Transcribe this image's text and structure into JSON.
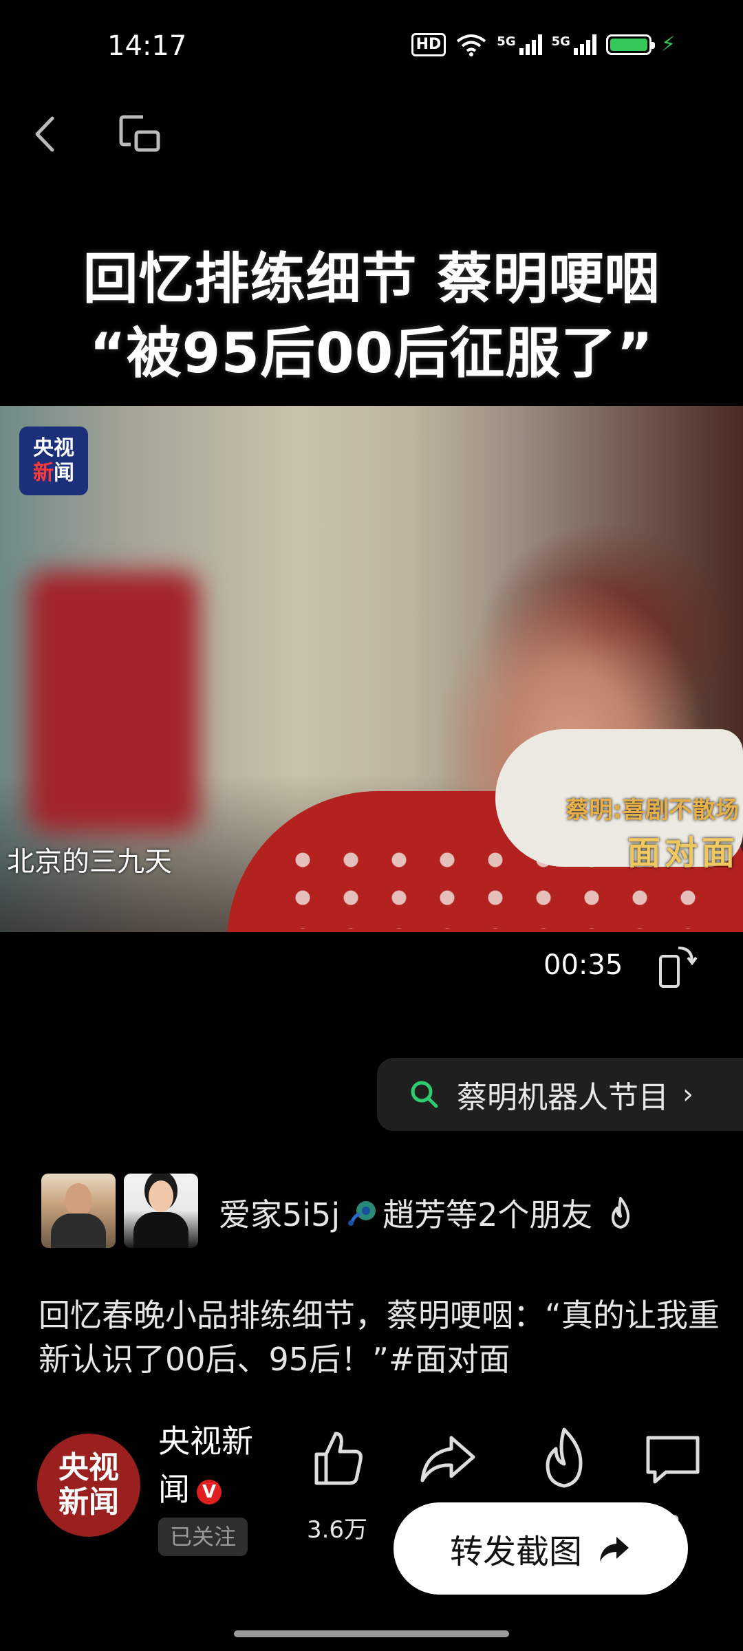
{
  "status_bar": {
    "time": "14:17",
    "hd": "HD",
    "net1": "5G",
    "net2": "5G",
    "battery_color": "#34c759"
  },
  "headline": {
    "line1": "回忆排练细节 蔡明哽咽",
    "line2": "“被95后00后征服了”"
  },
  "video": {
    "channel_logo_top": "央视",
    "channel_logo_bottom_a": "新",
    "channel_logo_bottom_b": "闻",
    "caption": "北京的三九天",
    "corner_sub": "蔡明:喜剧不散场",
    "corner_brand": "面对面"
  },
  "player": {
    "time": "00:35"
  },
  "search_chip": {
    "text": "蔡明机器人节目",
    "chevron": "›"
  },
  "friends": {
    "text": "爱家5i5j",
    "text_after": "趙芳等2个朋友"
  },
  "post": {
    "description": "回忆春晚小品排练细节，蔡明哽咽：“真的让我重新认识了00后、95后！”#面对面"
  },
  "author": {
    "avatar_line1": "央视",
    "avatar_line2": "新闻",
    "name": "央视新闻",
    "verified": "V",
    "follow_label": "已关注"
  },
  "actions": {
    "like_count": "3.6万",
    "comment_count": "3"
  },
  "float_button": {
    "label": "转发截图"
  },
  "colors": {
    "accent_green": "#34c759",
    "brand_blue": "#1b2f7a",
    "brand_red": "#9a1f1f",
    "corner_gold": "#f0c860"
  }
}
